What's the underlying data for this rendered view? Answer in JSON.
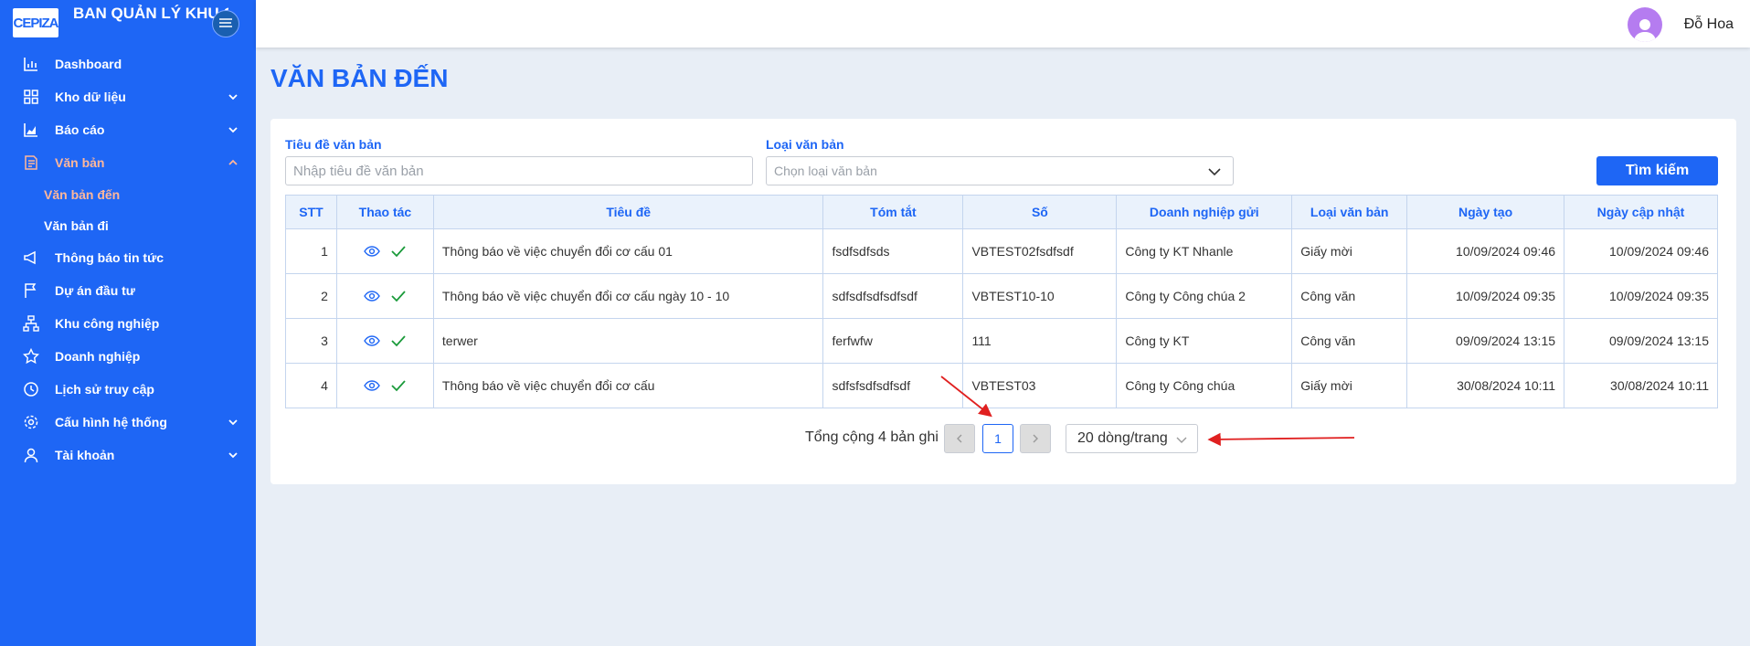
{
  "brand": {
    "logo_text": "CEPIZA",
    "title": "BAN QUẢN LÝ KHU CHẾ XUẤT KHU CN"
  },
  "menu": {
    "dashboard": "Dashboard",
    "data_store": "Kho dữ liệu",
    "reports": "Báo cáo",
    "documents": "Văn bản",
    "incoming_docs": "Văn bản đến",
    "outgoing_docs": "Văn bản đi",
    "news": "Thông báo tin tức",
    "projects": "Dự án đầu tư",
    "industrial_zones": "Khu công nghiệp",
    "enterprises": "Doanh nghiệp",
    "access_history": "Lịch sử truy cập",
    "system_config": "Cấu hình hệ thống",
    "account": "Tài khoản"
  },
  "header": {
    "user_name": "Đỗ Hoa"
  },
  "page": {
    "title": "VĂN BẢN ĐẾN"
  },
  "filters": {
    "title_label": "Tiêu đề văn bản",
    "title_placeholder": "Nhập tiêu đề văn bản",
    "type_label": "Loại văn bản",
    "type_placeholder": "Chọn loại văn bản",
    "search_button": "Tìm kiếm"
  },
  "table": {
    "columns": [
      "STT",
      "Thao tác",
      "Tiêu đề",
      "Tóm tắt",
      "Số",
      "Doanh nghiệp gửi",
      "Loại văn bản",
      "Ngày tạo",
      "Ngày cập nhật"
    ],
    "rows": [
      {
        "stt": "1",
        "title": "Thông báo về việc chuyển đổi cơ cấu 01",
        "summary": "fsdfsdfsds",
        "number": "VBTEST02fsdfsdf",
        "sender": "Công ty KT Nhanle",
        "type": "Giấy mời",
        "created": "10/09/2024 09:46",
        "updated": "10/09/2024 09:46"
      },
      {
        "stt": "2",
        "title": "Thông báo về việc chuyển đổi cơ cấu ngày 10 - 10",
        "summary": "sdfsdfsdfsdfsdf",
        "number": "VBTEST10-10",
        "sender": "Công ty Công chúa 2",
        "type": "Công văn",
        "created": "10/09/2024 09:35",
        "updated": "10/09/2024 09:35"
      },
      {
        "stt": "3",
        "title": "terwer",
        "summary": "ferfwfw",
        "number": "111",
        "sender": "Công ty KT",
        "type": "Công văn",
        "created": "09/09/2024 13:15",
        "updated": "09/09/2024 13:15"
      },
      {
        "stt": "4",
        "title": "Thông báo về việc chuyển đổi cơ cấu",
        "summary": "sdfsfsdfsdfsdf",
        "number": "VBTEST03",
        "sender": "Công ty Công chúa",
        "type": "Giấy mời",
        "created": "30/08/2024 10:11",
        "updated": "30/08/2024 10:11"
      }
    ]
  },
  "pagination": {
    "total_text": "Tổng cộng 4 bản ghi",
    "current_page": "1",
    "page_size": "20 dòng/trang"
  },
  "colors": {
    "primary": "#1e66f5",
    "active_menu": "#ffb79a",
    "annotation": "#e02020"
  }
}
